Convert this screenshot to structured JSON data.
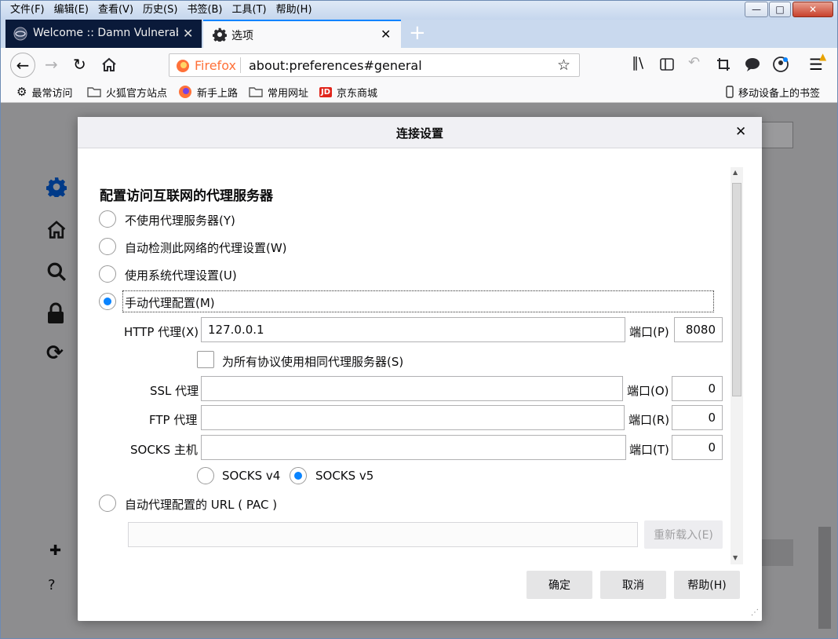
{
  "menubar": {
    "items": [
      "文件(F)",
      "编辑(E)",
      "查看(V)",
      "历史(S)",
      "书签(B)",
      "工具(T)",
      "帮助(H)"
    ]
  },
  "window_controls": {
    "minimize": "—",
    "maximize": "□",
    "close": "✕"
  },
  "tabs": [
    {
      "label": "Welcome :: Damn Vulnerable",
      "active": false
    },
    {
      "label": "选项",
      "active": true
    }
  ],
  "navbar": {
    "identity_label": "Firefox",
    "url": "about:preferences#general"
  },
  "bookmarks": {
    "items": [
      "最常访问",
      "火狐官方站点",
      "新手上路",
      "常用网址",
      "京东商城"
    ],
    "jd_logo": "JD",
    "mobile": "移动设备上的书签"
  },
  "dialog": {
    "title": "连接设置",
    "close": "✕",
    "heading": "配置访问互联网的代理服务器",
    "options": [
      {
        "label": "不使用代理服务器(Y)",
        "selected": false
      },
      {
        "label": "自动检测此网络的代理设置(W)",
        "selected": false
      },
      {
        "label": "使用系统代理设置(U)",
        "selected": false
      },
      {
        "label": "手动代理配置(M)",
        "selected": true
      }
    ],
    "http": {
      "label": "HTTP 代理(X)",
      "value": "127.0.0.1",
      "port_label": "端口(P)",
      "port": "8080"
    },
    "same_proxy": {
      "label": "为所有协议使用相同代理服务器(S)",
      "checked": false
    },
    "ssl": {
      "label": "SSL 代理",
      "value": "",
      "port_label": "端口(O)",
      "port": "0"
    },
    "ftp": {
      "label": "FTP 代理",
      "value": "",
      "port_label": "端口(R)",
      "port": "0"
    },
    "socks": {
      "label": "SOCKS 主机",
      "value": "",
      "port_label": "端口(T)",
      "port": "0"
    },
    "socks_v4": {
      "label": "SOCKS v4",
      "selected": false
    },
    "socks_v5": {
      "label": "SOCKS v5",
      "selected": true
    },
    "pac": {
      "label": "自动代理配置的 URL ( PAC )",
      "selected": false,
      "value": "",
      "reload_label": "重新载入(E)"
    },
    "buttons": {
      "ok": "确定",
      "cancel": "取消",
      "help": "帮助(H)"
    }
  },
  "colors": {
    "accent": "#0a84ff",
    "overlay": "#8d8d8f",
    "firefox_orange": "#ff7139",
    "jd_red": "#e1251b"
  }
}
